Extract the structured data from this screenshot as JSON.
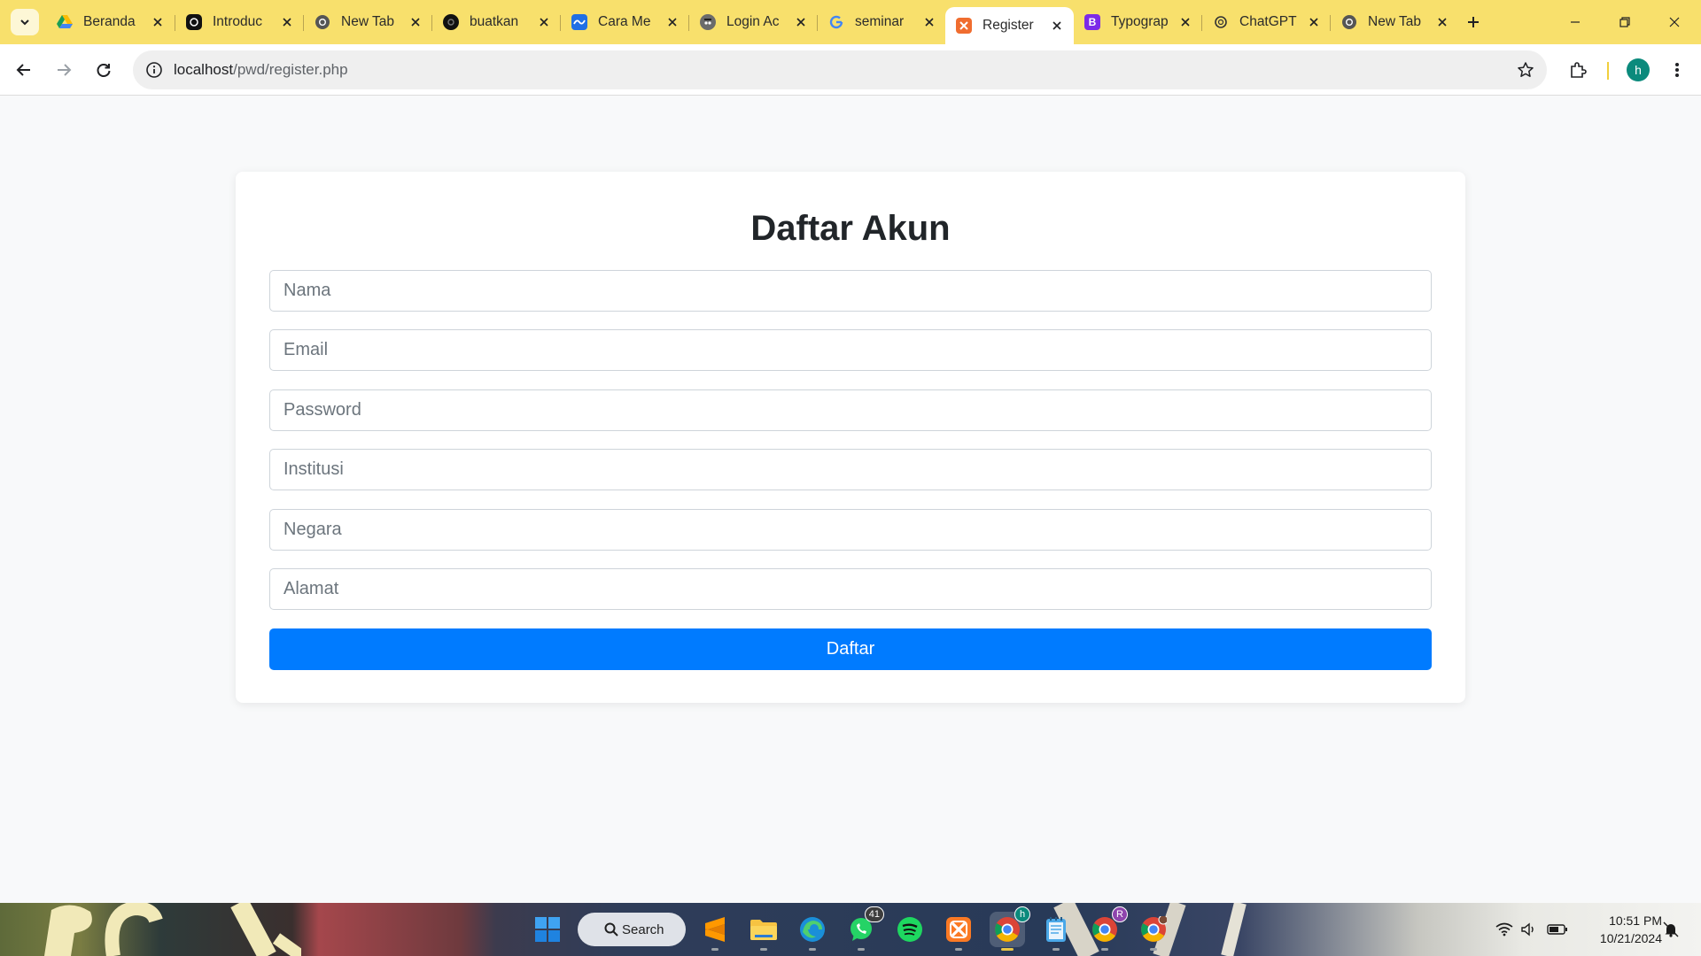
{
  "browser": {
    "tabs": [
      {
        "title": "Beranda",
        "favicon": "google-drive-icon",
        "active": false
      },
      {
        "title": "Introduc",
        "favicon": "openai-icon",
        "active": false
      },
      {
        "title": "New Tab",
        "favicon": "chrome-icon",
        "active": false
      },
      {
        "title": "buatkan",
        "favicon": "openai-dark-icon",
        "active": false
      },
      {
        "title": "Cara Me",
        "favicon": "blue-wave-icon",
        "active": false
      },
      {
        "title": "Login Ac",
        "favicon": "spy-icon",
        "active": false
      },
      {
        "title": "seminar",
        "favicon": "google-icon",
        "active": false
      },
      {
        "title": "Register",
        "favicon": "xampp-icon",
        "active": true
      },
      {
        "title": "Typograp",
        "favicon": "bootstrap-icon",
        "active": false
      },
      {
        "title": "ChatGPT",
        "favicon": "openai-icon",
        "active": false
      },
      {
        "title": "New Tab",
        "favicon": "chrome-icon",
        "active": false
      }
    ],
    "url_host": "localhost",
    "url_path": "/pwd/register.php",
    "profile_initial": "h",
    "colors": {
      "tabstrip": "#f8e06c",
      "accent": "#007bff",
      "avatar": "#0b8a7c"
    }
  },
  "form": {
    "title": "Daftar Akun",
    "fields": {
      "nama": "Nama",
      "email": "Email",
      "password": "Password",
      "institusi": "Institusi",
      "negara": "Negara",
      "alamat": "Alamat"
    },
    "submit_label": "Daftar"
  },
  "taskbar": {
    "search_label": "Search",
    "whatsapp_badge": "41",
    "chrome_h_badge": "h",
    "chrome_r_badge": "R",
    "time": "10:51 PM",
    "date": "10/21/2024"
  }
}
